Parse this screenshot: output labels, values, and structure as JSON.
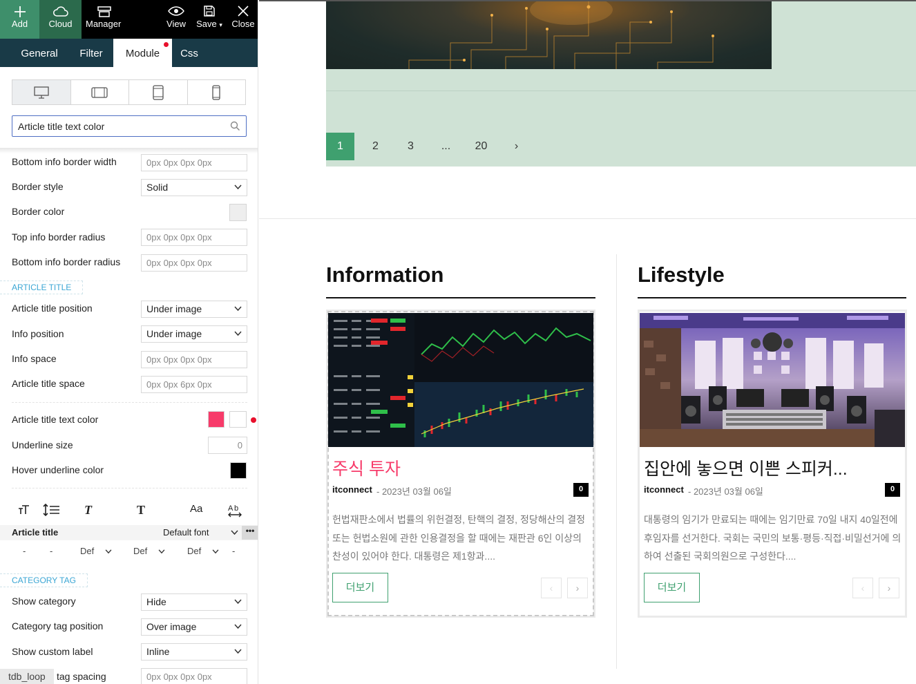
{
  "toolbar": {
    "add": "Add",
    "cloud": "Cloud",
    "manager": "Manager",
    "view": "View",
    "save": "Save",
    "close": "Close"
  },
  "tabs": {
    "general": "General",
    "filter": "Filter",
    "module": "Module",
    "css": "Css"
  },
  "search": {
    "value": "Article title text color"
  },
  "settings": {
    "bottom_info_border_width": {
      "label": "Bottom info border width",
      "value": "0px 0px 0px 0px"
    },
    "border_style": {
      "label": "Border style",
      "value": "Solid"
    },
    "border_color": {
      "label": "Border color",
      "color": "#eeeeee"
    },
    "top_info_border_radius": {
      "label": "Top info border radius",
      "value": "0px 0px 0px 0px"
    },
    "bottom_info_border_radius": {
      "label": "Bottom info border radius",
      "value": "0px 0px 0px 0px"
    },
    "article_title_section": "ARTICLE TITLE",
    "article_title_position": {
      "label": "Article title position",
      "value": "Under image"
    },
    "info_position": {
      "label": "Info position",
      "value": "Under image"
    },
    "info_space": {
      "label": "Info space",
      "value": "0px 0px 0px 0px"
    },
    "article_title_space": {
      "label": "Article title space",
      "value": "0px 0px 6px 0px"
    },
    "article_title_text_color": {
      "label": "Article title text color",
      "color": "#f73b6a",
      "hover_color": "#ffffff"
    },
    "underline_size": {
      "label": "Underline size",
      "value": "0"
    },
    "hover_underline_color": {
      "label": "Hover underline color",
      "color": "#000000"
    },
    "font": {
      "label": "Article title",
      "value": "Default font",
      "more": "•••",
      "sub": [
        "-",
        "-",
        "Def",
        "Def",
        "Def",
        "-"
      ]
    },
    "category_tag_section": "CATEGORY TAG",
    "show_category": {
      "label": "Show category",
      "value": "Hide"
    },
    "category_tag_position": {
      "label": "Category tag position",
      "value": "Over image"
    },
    "show_custom_label": {
      "label": "Show custom label",
      "value": "Inline"
    },
    "tag_spacing": {
      "label": "tag spacing",
      "value": "0px 0px 0px 0px"
    }
  },
  "status_tag": "tdb_loop",
  "pagination": [
    "1",
    "2",
    "3",
    "...",
    "20",
    "›"
  ],
  "blocks": [
    {
      "title": "Information",
      "article": {
        "title": "주식 투자",
        "title_color": "#f73b6a",
        "author": "itconnect",
        "date": "2023년 03월 06일",
        "comments": "0",
        "excerpt": "헌법재판소에서 법률의 위헌결정, 탄핵의 결정, 정당해산의 결정 또는 헌법소원에 관한 인용결정을 할 때에는 재판관 6인 이상의 찬성이 있어야 한다. 대통령은 제1항과....",
        "more": "더보기"
      }
    },
    {
      "title": "Lifestyle",
      "article": {
        "title": "집안에 놓으면 이쁜 스피커...",
        "title_color": "#111111",
        "author": "itconnect",
        "date": "2023년 03월 06일",
        "comments": "0",
        "excerpt": "대통령의 임기가 만료되는 때에는 임기만료 70일 내지 40일전에 후임자를 선거한다. 국회는 국민의 보통·평등·직접·비밀선거에 의하여 선출된 국회의원으로 구성한다....",
        "more": "더보기"
      }
    }
  ],
  "nav": {
    "prev": "‹",
    "next": "›"
  }
}
